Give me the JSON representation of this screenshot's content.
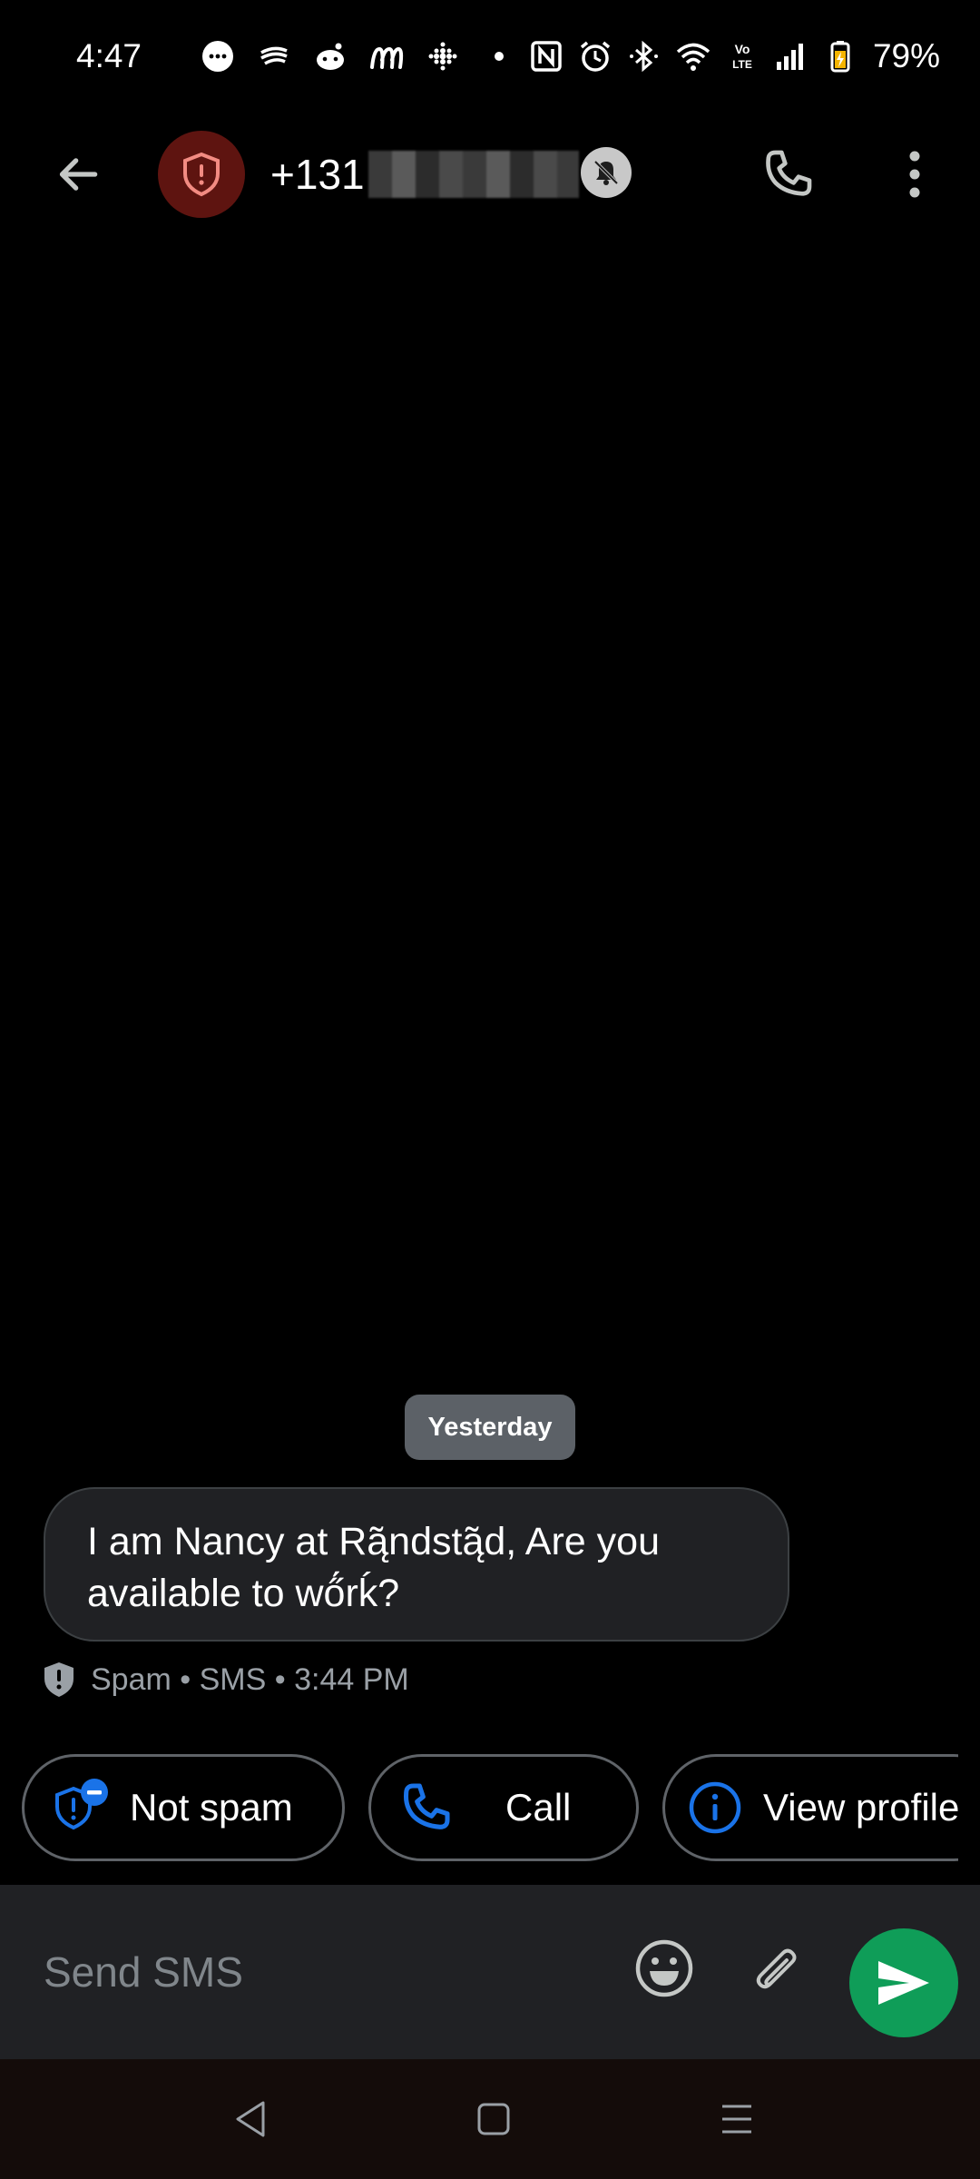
{
  "status_bar": {
    "time": "4:47",
    "battery_percent": "79%",
    "icons_left": [
      "chat-bubble-icon",
      "wind-icon",
      "reddit-icon",
      "m-app-icon",
      "dots-grid-icon",
      "dot-icon"
    ],
    "icons_right": [
      "nfc-icon",
      "alarm-icon",
      "bluetooth-icon",
      "wifi-icon",
      "volte-icon",
      "signal-icon",
      "battery-icon"
    ],
    "volte_label": "Vo\nLTE"
  },
  "header": {
    "contact_number_visible": "+131",
    "avatar_icon": "shield-alert-icon",
    "avatar_color": "#5e1410"
  },
  "conversation": {
    "date_label": "Yesterday",
    "messages": [
      {
        "text": "I am Nancy at Rą̃ndstą̃d, Are you available to wő́rḱ?",
        "meta": "Spam • SMS • 3:44 PM"
      }
    ]
  },
  "suggestions": {
    "not_spam": "Not spam",
    "call": "Call",
    "view_profile": "View profile",
    "accent_color": "#1a73e8"
  },
  "compose": {
    "placeholder": "Send SMS",
    "send_color": "#0f9d58"
  }
}
